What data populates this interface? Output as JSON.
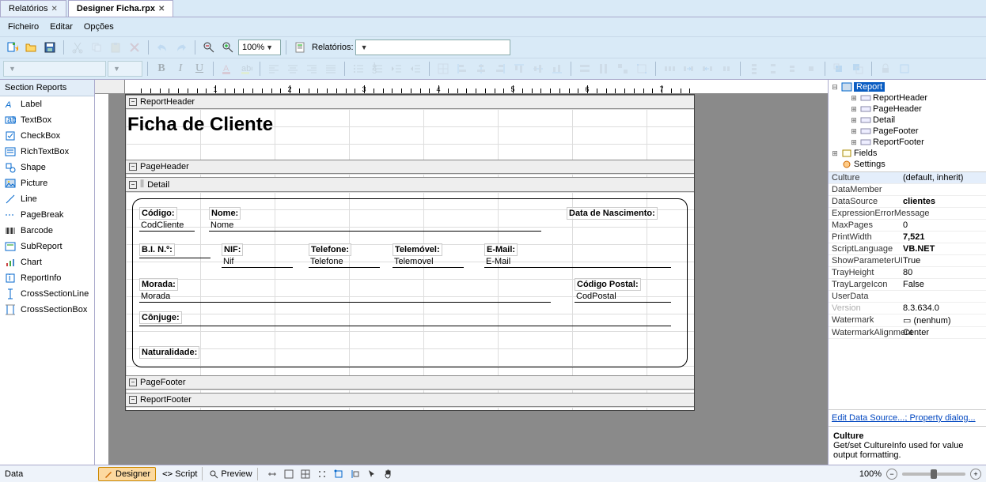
{
  "tabs": [
    {
      "label": "Relatórios",
      "active": false
    },
    {
      "label": "Designer Ficha.rpx",
      "active": true
    }
  ],
  "menu": [
    "Ficheiro",
    "Editar",
    "Opções"
  ],
  "zoom_combo": "100%",
  "report_combo_label": "Relatórios:",
  "toolbox": {
    "header": "Section Reports",
    "items": [
      "Label",
      "TextBox",
      "CheckBox",
      "RichTextBox",
      "Shape",
      "Picture",
      "Line",
      "PageBreak",
      "Barcode",
      "SubReport",
      "Chart",
      "ReportInfo",
      "CrossSectionLine",
      "CrossSectionBox"
    ]
  },
  "sections": {
    "report_header": "ReportHeader",
    "page_header": "PageHeader",
    "detail": "Detail",
    "page_footer": "PageFooter",
    "report_footer": "ReportFooter"
  },
  "title": "Ficha de Cliente",
  "fields": {
    "codigo_l": "Código:",
    "codigo_v": "CodCliente",
    "nome_l": "Nome:",
    "nome_v": "Nome",
    "datanasc_l": "Data de Nascimento:",
    "bi_l": "B.I. N.º:",
    "nif_l": "NIF:",
    "nif_v": "Nif",
    "tel_l": "Telefone:",
    "tel_v": "Telefone",
    "telm_l": "Telemóvel:",
    "telm_v": "Telemovel",
    "email_l": "E-Mail:",
    "email_v": "E-Mail",
    "morada_l": "Morada:",
    "morada_v": "Morada",
    "cp_l": "Código Postal:",
    "cp_v": "CodPostal",
    "conj_l": "Cônjuge:",
    "nat_l": "Naturalidade:"
  },
  "tree": {
    "root": "Report",
    "children": [
      "ReportHeader",
      "PageHeader",
      "Detail",
      "PageFooter",
      "ReportFooter"
    ],
    "fields": "Fields",
    "settings": "Settings"
  },
  "props": [
    {
      "n": "Culture",
      "v": "(default, inherit)",
      "sel": true
    },
    {
      "n": "DataMember",
      "v": ""
    },
    {
      "n": "DataSource",
      "v": "clientes",
      "b": true,
      "arrow": true
    },
    {
      "n": "ExpressionErrorMessage",
      "v": ""
    },
    {
      "n": "MaxPages",
      "v": "0"
    },
    {
      "n": "PrintWidth",
      "v": "7,521",
      "b": true
    },
    {
      "n": "ScriptLanguage",
      "v": "VB.NET",
      "b": true
    },
    {
      "n": "ShowParameterUI",
      "v": "True"
    },
    {
      "n": "TrayHeight",
      "v": "80"
    },
    {
      "n": "TrayLargeIcon",
      "v": "False"
    },
    {
      "n": "UserData",
      "v": ""
    },
    {
      "n": "Version",
      "v": "8.3.634.0",
      "dim": true
    },
    {
      "n": "Watermark",
      "v": "▭  (nenhum)"
    },
    {
      "n": "WatermarkAlignment",
      "v": "Center"
    }
  ],
  "links": {
    "edit_ds": "Edit Data Source...",
    "prop_dlg": "Property dialog..."
  },
  "help": {
    "title": "Culture",
    "body": "Get/set CultureInfo used for value output formatting."
  },
  "status": {
    "left": "Data",
    "views": [
      "Designer",
      "Script",
      "Preview"
    ],
    "zoom": "100%"
  },
  "ruler_numbers": [
    1,
    2,
    3,
    4,
    5,
    6,
    7
  ]
}
